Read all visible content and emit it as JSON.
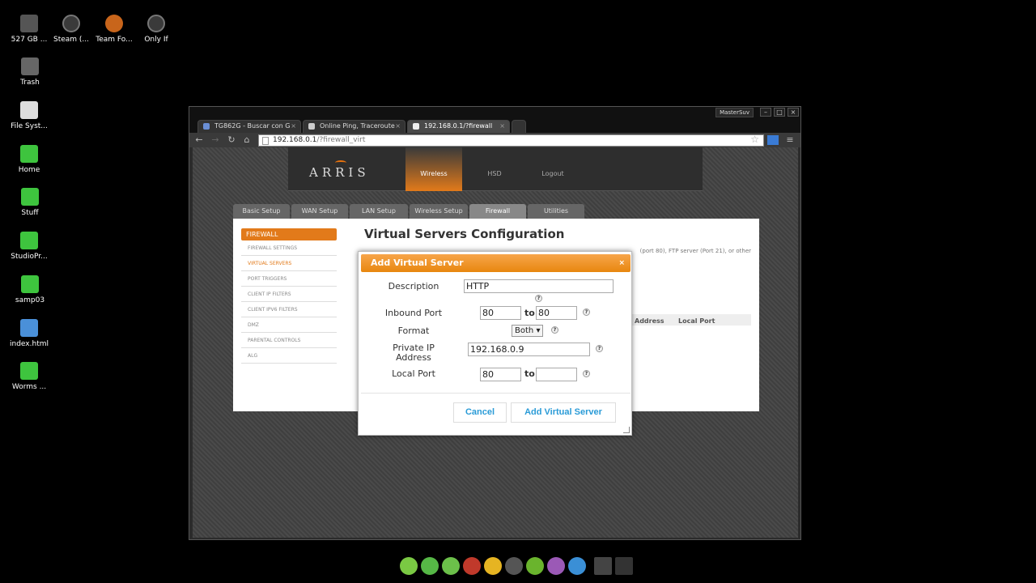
{
  "desktop": {
    "icons": [
      {
        "label": "527 GB ...",
        "icon": "disk-icon"
      },
      {
        "label": "Steam (...",
        "icon": "steam-icon"
      },
      {
        "label": "Team Fo...",
        "icon": "team-fortress-icon"
      },
      {
        "label": "Only If",
        "icon": "steam-icon"
      },
      {
        "label": "Trash",
        "icon": "trash-icon"
      },
      {
        "label": "File Syst...",
        "icon": "filesystem-icon"
      },
      {
        "label": "Home",
        "icon": "home-folder-icon"
      },
      {
        "label": "Stuff",
        "icon": "folder-icon"
      },
      {
        "label": "StudioPr...",
        "icon": "folder-icon"
      },
      {
        "label": "samp03",
        "icon": "folder-icon"
      },
      {
        "label": "index.html",
        "icon": "html-file-icon"
      },
      {
        "label": "Worms ...",
        "icon": "folder-icon"
      }
    ]
  },
  "browser": {
    "user": "MasterSuv",
    "window_buttons": [
      "–",
      "□",
      "×"
    ],
    "tabs": [
      {
        "title": "TG862G - Buscar con G"
      },
      {
        "title": "Online Ping, Traceroute"
      },
      {
        "title": "192.168.0.1/?firewall"
      }
    ],
    "address": {
      "host": "192.168.0.1",
      "path": "/?firewall_virt"
    }
  },
  "router": {
    "brand": "ARRIS",
    "topnav": [
      "Wireless",
      "HSD",
      "Logout"
    ],
    "mainnav": [
      "Basic Setup",
      "WAN Setup",
      "LAN Setup",
      "Wireless Setup",
      "Firewall",
      "Utilities"
    ],
    "sidebar": {
      "heading": "FIREWALL",
      "items": [
        "FIREWALL SETTINGS",
        "VIRTUAL SERVERS",
        "PORT TRIGGERS",
        "CLIENT IP FILTERS",
        "CLIENT IPV6 FILTERS",
        "DMZ",
        "PARENTAL CONTROLS",
        "ALG"
      ]
    },
    "title": "Virtual Servers Configuration",
    "intro": "(port 80), FTP server (Port 21), or other",
    "columns": [
      "Address",
      "Local Port"
    ]
  },
  "modal": {
    "title": "Add Virtual Server",
    "close": "×",
    "description": {
      "label": "Description",
      "value": "HTTP"
    },
    "inbound": {
      "label": "Inbound Port",
      "from": "80",
      "to_label": "to",
      "to": "80"
    },
    "format": {
      "label": "Format",
      "value": "Both"
    },
    "private_ip": {
      "label": "Private IP Address",
      "value": "192.168.0.9"
    },
    "local_port": {
      "label": "Local Port",
      "from": "80",
      "to_label": "to",
      "to": ""
    },
    "help": "?",
    "cancel": "Cancel",
    "submit": "Add Virtual Server"
  },
  "dock": {
    "items": [
      {
        "icon": "anchor-icon",
        "color": "#7ac943"
      },
      {
        "icon": "utorrent-icon",
        "color": "#56b846"
      },
      {
        "icon": "settings-icon",
        "color": "#6cc04a"
      },
      {
        "icon": "filezilla-icon",
        "color": "#c0392b"
      },
      {
        "icon": "chrome-icon",
        "color": "#e6b422"
      },
      {
        "icon": "terminal-icon",
        "color": "#555555"
      },
      {
        "icon": "spotify-icon",
        "color": "#6ab42d"
      },
      {
        "icon": "document-icon",
        "color": "#9b59b6"
      },
      {
        "icon": "camera-icon",
        "color": "#3a8fd6"
      },
      {
        "icon": "trash-icon",
        "color": "#444444"
      },
      {
        "icon": "window-manager-icon",
        "color": "#333333"
      }
    ]
  }
}
